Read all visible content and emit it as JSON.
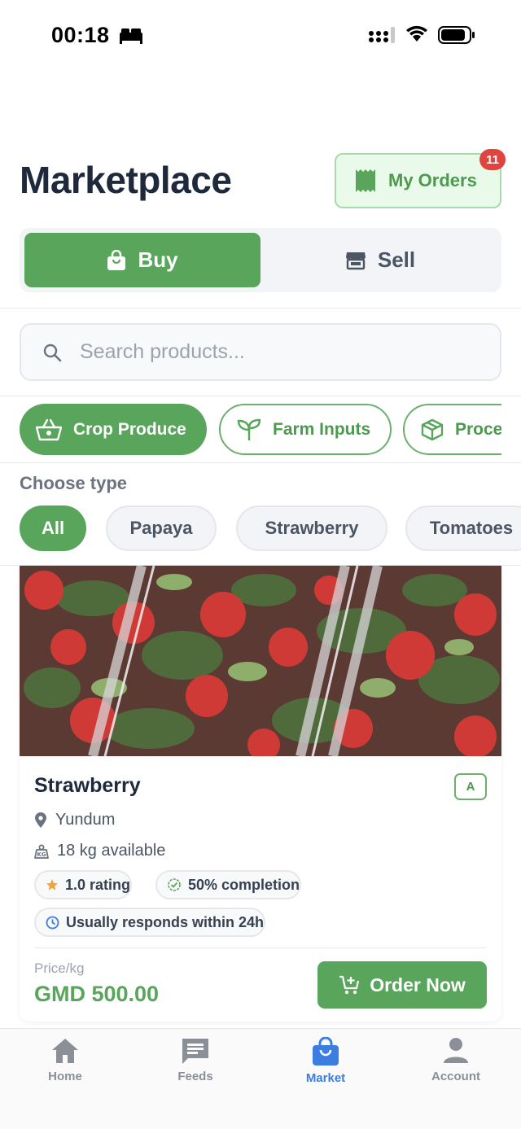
{
  "status_bar": {
    "time": "00:18"
  },
  "header": {
    "title": "Marketplace",
    "orders_label": "My Orders",
    "orders_count": "11"
  },
  "segment": {
    "buy_label": "Buy",
    "sell_label": "Sell",
    "selected": "Buy"
  },
  "search": {
    "placeholder": "Search products..."
  },
  "categories": [
    {
      "label": "Crop Produce",
      "icon": "basket-icon",
      "selected": true
    },
    {
      "label": "Farm Inputs",
      "icon": "sprout-icon",
      "selected": false
    },
    {
      "label": "Proce",
      "icon": "box-icon",
      "selected": false
    }
  ],
  "types": {
    "heading": "Choose type",
    "items": [
      {
        "label": "All",
        "selected": true
      },
      {
        "label": "Papaya",
        "selected": false
      },
      {
        "label": "Strawberry",
        "selected": false
      },
      {
        "label": "Tomatoes",
        "selected": false
      }
    ]
  },
  "product": {
    "name": "Strawberry",
    "grade": "A",
    "location": "Yundum",
    "availability": "18 kg available",
    "rating": "1.0 rating",
    "completion": "50% completion",
    "response": "Usually responds within 24h",
    "price_label": "Price/kg",
    "price": "GMD 500.00",
    "order_label": "Order Now"
  },
  "tabbar": {
    "items": [
      {
        "label": "Home",
        "icon": "home-icon",
        "active": false
      },
      {
        "label": "Feeds",
        "icon": "chat-icon",
        "active": false
      },
      {
        "label": "Market",
        "icon": "shopping-bag-icon",
        "active": true
      },
      {
        "label": "Account",
        "icon": "person-icon",
        "active": false
      }
    ]
  },
  "colors": {
    "primary": "#58a55b",
    "active_tab": "#3b7de0",
    "badge": "#e0443e",
    "title": "#1e293b"
  }
}
